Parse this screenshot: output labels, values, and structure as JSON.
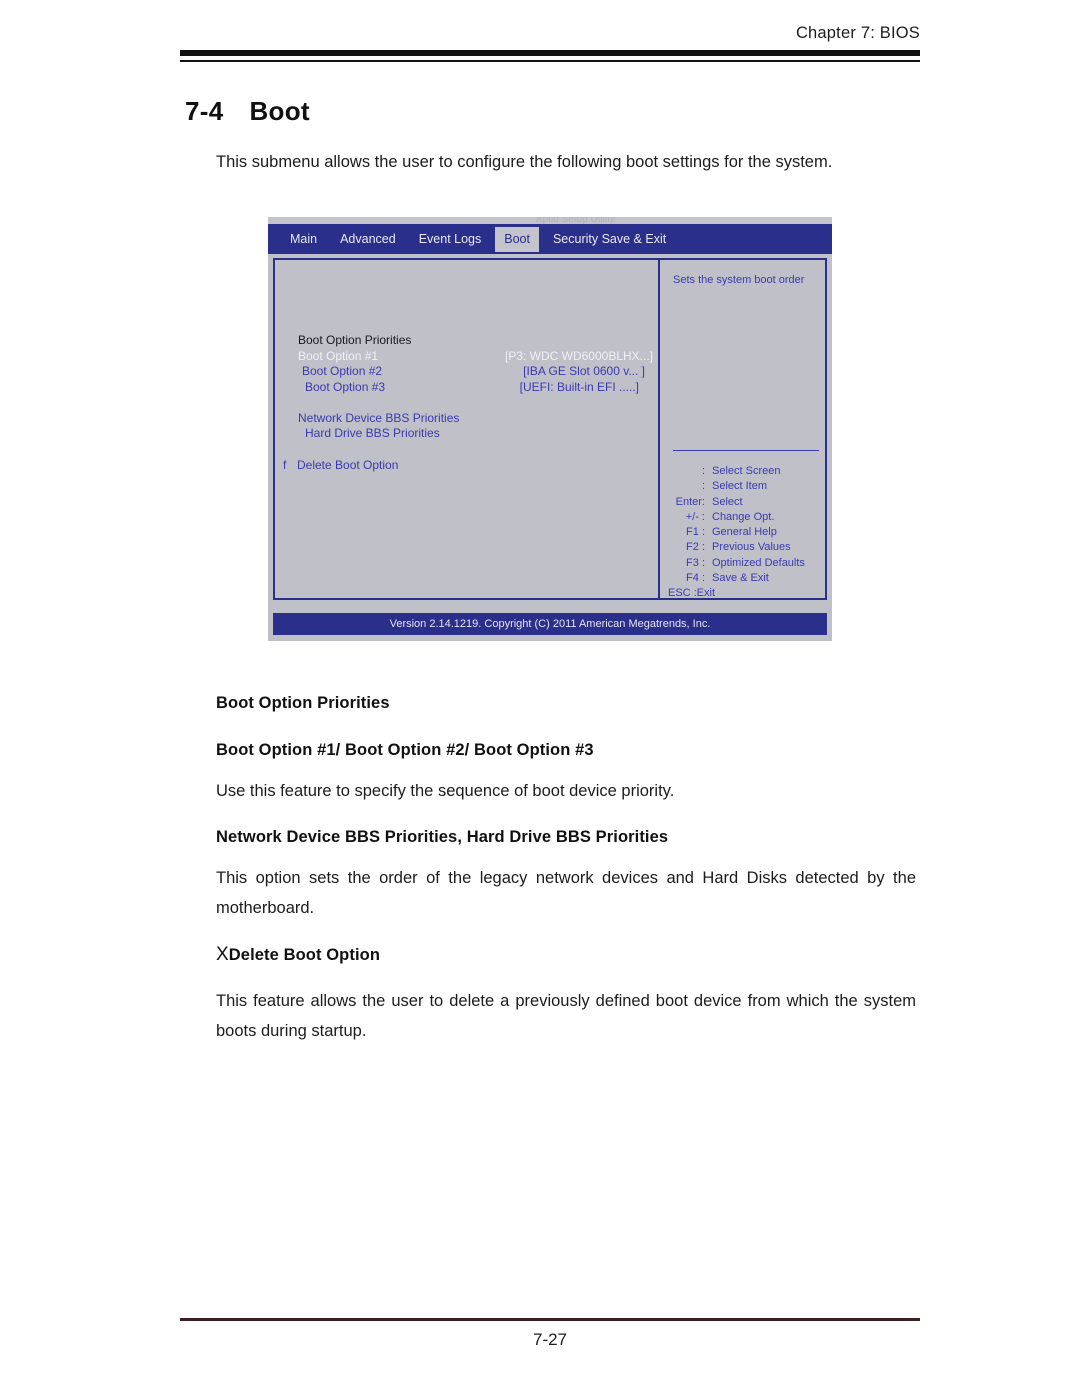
{
  "page": {
    "chapter_header": "Chapter 7: BIOS",
    "section_number": "7-4",
    "section_title": "Boot",
    "intro": "This submenu allows the user to configure the following boot settings for the system.",
    "page_number": "7-27"
  },
  "bios": {
    "ghost_line": "Aptio Setup Utility",
    "menu": [
      {
        "label": "Main",
        "active": false
      },
      {
        "label": "Advanced",
        "active": false
      },
      {
        "label": "Event Logs",
        "active": false
      },
      {
        "label": "Boot",
        "active": true
      },
      {
        "label": "Security Save & Exit",
        "active": false
      }
    ],
    "section_heading": "Boot Option Priorities",
    "options": [
      {
        "label": "Boot Option #1",
        "value": "[P3: WDC WD6000BLHX...]",
        "selected": true
      },
      {
        "label": "Boot Option #2",
        "value": "[IBA GE Slot 0600 v... ]",
        "selected": false
      },
      {
        "label": "Boot Option #3",
        "value": "[UEFI: Built-in EFI .....]",
        "selected": false
      }
    ],
    "submenus": [
      "Network Device BBS Priorities",
      "Hard Drive BBS Priorities"
    ],
    "delete_glyph": "f",
    "delete_item": "Delete Boot Option",
    "help_text": "Sets the system boot order",
    "keys": [
      {
        "key": ":",
        "desc": "Select Screen"
      },
      {
        "key": ":",
        "desc": "Select Item"
      },
      {
        "key": "Enter:",
        "desc": "Select"
      },
      {
        "key": "+/-  :",
        "desc": "Change Opt."
      },
      {
        "key": "F1 :",
        "desc": "General Help"
      },
      {
        "key": "F2 :",
        "desc": "Previous Values"
      },
      {
        "key": "F3 :",
        "desc": "Optimized Defaults"
      },
      {
        "key": "F4 :",
        "desc": "Save & Exit"
      }
    ],
    "key_esc": {
      "key": "ESC",
      "desc": ":Exit"
    },
    "footer": "Version 2.14.1219. Copyright (C) 2011 American Megatrends, Inc.",
    "colors": {
      "bar_blue": "#2b2f8c",
      "panel_gray": "#c0c0c8",
      "text_blue": "#3a3ab0"
    }
  },
  "sections": [
    {
      "heading": "Boot Option Priorities",
      "subheading": "Boot Option #1/ Boot Option #2/ Boot Option #3",
      "body": "Use this feature to specify the sequence of boot device priority."
    },
    {
      "heading": "Network Device BBS Priorities, Hard Drive BBS Priorities",
      "body": "This option sets the order of the legacy network devices and Hard Disks detected by the motherboard."
    },
    {
      "glyph": "X",
      "heading": "Delete Boot Option",
      "body": "This feature allows the user to delete a previously defined  boot device from which the system boots during startup."
    }
  ]
}
